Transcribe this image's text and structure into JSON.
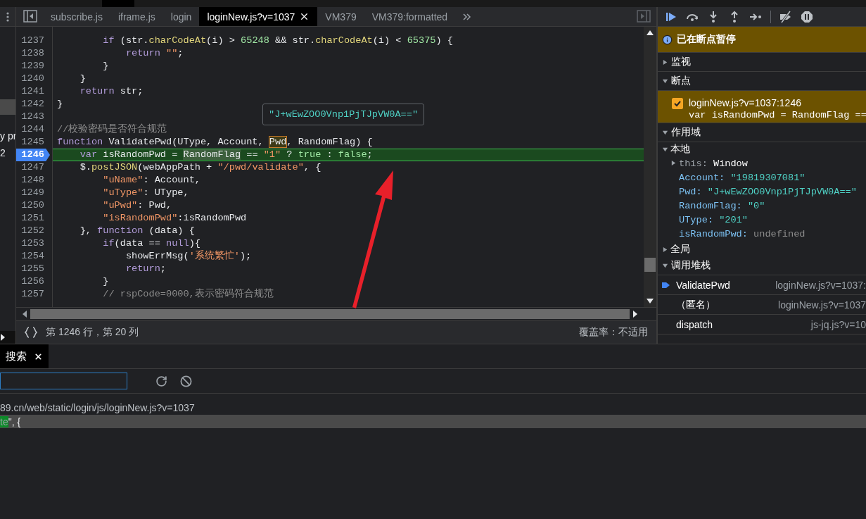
{
  "navigator": {
    "items": [
      {
        "label": "y pr"
      },
      {
        "label": "2"
      }
    ]
  },
  "tabs": [
    {
      "label": "subscribe.js",
      "selected": false
    },
    {
      "label": "iframe.js",
      "selected": false
    },
    {
      "label": "login",
      "selected": false
    },
    {
      "label": "loginNew.js?v=1037",
      "selected": true
    },
    {
      "label": "VM379",
      "selected": false
    },
    {
      "label": "VM379:formatted",
      "selected": false
    }
  ],
  "editor": {
    "tooltip": "\"J+wEwZOO0Vnp1PjTJpVW0A==\"",
    "lines": [
      {
        "number": "1237",
        "current": false,
        "tokens": [
          {
            "kind": "kw",
            "text": "        if"
          },
          {
            "kind": "plain",
            "text": " (str."
          },
          {
            "kind": "fn",
            "text": "charCodeAt"
          },
          {
            "kind": "plain",
            "text": "(i) > "
          },
          {
            "kind": "num",
            "text": "65248"
          },
          {
            "kind": "plain",
            "text": " && str."
          },
          {
            "kind": "fn",
            "text": "charCodeAt"
          },
          {
            "kind": "plain",
            "text": "(i) < "
          },
          {
            "kind": "num",
            "text": "65375"
          },
          {
            "kind": "plain",
            "text": ") {"
          }
        ]
      },
      {
        "number": "1238",
        "current": false,
        "tokens": [
          {
            "kind": "kw",
            "text": "            return "
          },
          {
            "kind": "str",
            "text": "\"\""
          },
          {
            "kind": "plain",
            "text": ";"
          }
        ]
      },
      {
        "number": "1239",
        "current": false,
        "tokens": [
          {
            "kind": "plain",
            "text": "        }"
          }
        ]
      },
      {
        "number": "1240",
        "current": false,
        "tokens": [
          {
            "kind": "plain",
            "text": "    }"
          }
        ]
      },
      {
        "number": "1241",
        "current": false,
        "tokens": [
          {
            "kind": "kw",
            "text": "    return"
          },
          {
            "kind": "plain",
            "text": " str;"
          }
        ]
      },
      {
        "number": "1242",
        "current": false,
        "tokens": [
          {
            "kind": "plain",
            "text": "}"
          }
        ]
      },
      {
        "number": "1243",
        "current": false
      },
      {
        "number": "1244",
        "current": false,
        "tokens": [
          {
            "kind": "cm",
            "text": "//校验密码是否符合规范"
          }
        ]
      },
      {
        "number": "1245",
        "current": false,
        "tokens": [
          {
            "kind": "kw",
            "text": "function"
          },
          {
            "kind": "plain",
            "text": " ValidatePwd(UType, Account, "
          },
          {
            "kind": "plain",
            "text": "Pwd",
            "hovered": true
          },
          {
            "kind": "plain",
            "text": ", RandomFlag) {"
          }
        ]
      },
      {
        "number": "1246",
        "current": true,
        "tokens": [
          {
            "kind": "kw",
            "text": "    var"
          },
          {
            "kind": "plain",
            "text": " isRandomPwd = "
          },
          {
            "kind": "plain",
            "text": "RandomFlag",
            "matched": true
          },
          {
            "kind": "plain",
            "text": " == "
          },
          {
            "kind": "str",
            "text": "\"1\""
          },
          {
            "kind": "plain",
            "text": " ? "
          },
          {
            "kind": "lit",
            "text": "true"
          },
          {
            "kind": "plain",
            "text": " : "
          },
          {
            "kind": "lit",
            "text": "false"
          },
          {
            "kind": "plain",
            "text": ";"
          }
        ]
      },
      {
        "number": "1247",
        "current": false,
        "tokens": [
          {
            "kind": "plain",
            "text": "    $."
          },
          {
            "kind": "fn",
            "text": "postJSON"
          },
          {
            "kind": "plain",
            "text": "(webAppPath + "
          },
          {
            "kind": "str",
            "text": "\"/pwd/validate\""
          },
          {
            "kind": "plain",
            "text": ", {"
          }
        ]
      },
      {
        "number": "1248",
        "current": false,
        "tokens": [
          {
            "kind": "str",
            "text": "        \"uName\""
          },
          {
            "kind": "plain",
            "text": ": Account,"
          }
        ]
      },
      {
        "number": "1249",
        "current": false,
        "tokens": [
          {
            "kind": "str",
            "text": "        \"uType\""
          },
          {
            "kind": "plain",
            "text": ": UType,"
          }
        ]
      },
      {
        "number": "1250",
        "current": false,
        "tokens": [
          {
            "kind": "str",
            "text": "        \"uPwd\""
          },
          {
            "kind": "plain",
            "text": ": Pwd,"
          }
        ]
      },
      {
        "number": "1251",
        "current": false,
        "tokens": [
          {
            "kind": "str",
            "text": "        \"isRandomPwd\""
          },
          {
            "kind": "plain",
            "text": ":isRandomPwd"
          }
        ]
      },
      {
        "number": "1252",
        "current": false,
        "tokens": [
          {
            "kind": "plain",
            "text": "    }, "
          },
          {
            "kind": "kw",
            "text": "function"
          },
          {
            "kind": "plain",
            "text": " (data) {"
          }
        ]
      },
      {
        "number": "1253",
        "current": false,
        "tokens": [
          {
            "kind": "kw",
            "text": "        if"
          },
          {
            "kind": "plain",
            "text": "(data == "
          },
          {
            "kind": "kw",
            "text": "null"
          },
          {
            "kind": "plain",
            "text": "){"
          }
        ]
      },
      {
        "number": "1254",
        "current": false,
        "tokens": [
          {
            "kind": "plain",
            "text": "            showErrMsg("
          },
          {
            "kind": "str",
            "text": "'系统繁忙'"
          },
          {
            "kind": "plain",
            "text": ");"
          }
        ]
      },
      {
        "number": "1255",
        "current": false,
        "tokens": [
          {
            "kind": "kw",
            "text": "            return"
          },
          {
            "kind": "plain",
            "text": ";"
          }
        ]
      },
      {
        "number": "1256",
        "current": false,
        "tokens": [
          {
            "kind": "plain",
            "text": "        }"
          }
        ]
      },
      {
        "number": "1257",
        "current": false,
        "tokens": [
          {
            "kind": "cm",
            "text": "        // rspCode=0000,表示密码符合规范"
          }
        ]
      }
    ]
  },
  "status_bar": {
    "position": "第 1246 行，第 20 列",
    "coverage": "覆盖率：不适用"
  },
  "debugger": {
    "paused_message": "已在断点暂停",
    "sections": [
      {
        "title": "监视",
        "expanded": false
      },
      {
        "title": "断点",
        "expanded": true,
        "items": [
          {
            "location": "loginNew.js?v=1037:1246",
            "code": "var isRandomPwd = RandomFlag ==",
            "checked": true
          }
        ]
      },
      {
        "title": "作用域",
        "expanded": true,
        "groups": [
          {
            "title": "本地",
            "expanded": true,
            "items": [
              {
                "name": "this:",
                "value": "Window",
                "kind": "object",
                "expanded": false
              },
              {
                "name": "Account:",
                "value": "\"19819307081\"",
                "kind": "string"
              },
              {
                "name": "Pwd:",
                "value": "\"J+wEwZOO0Vnp1PjTJpVW0A==\"",
                "kind": "string"
              },
              {
                "name": "RandomFlag:",
                "value": "\"0\"",
                "kind": "string"
              },
              {
                "name": "UType:",
                "value": "\"201\"",
                "kind": "string"
              },
              {
                "name": "isRandomPwd:",
                "value": "undefined",
                "kind": "undefined"
              }
            ]
          },
          {
            "title": "全局",
            "expanded": false
          }
        ]
      },
      {
        "title": "调用堆栈",
        "expanded": true,
        "frames": [
          {
            "name": "ValidatePwd",
            "location": "loginNew.js?v=1037:",
            "selected": true
          },
          {
            "name": "（匿名）",
            "location": "loginNew.js?v=1037",
            "selected": false
          },
          {
            "name": "dispatch",
            "location": "js-jq.js?v=10",
            "selected": false
          }
        ]
      }
    ]
  },
  "drawer": {
    "tabs": [
      {
        "label": "搜索",
        "selected": true
      }
    ],
    "results": [
      {
        "file": "89.cn/web/static/login/js/loginNew.js?v=1037",
        "lines": [
          {
            "match": "te",
            "text": "\", {"
          }
        ]
      }
    ]
  }
}
